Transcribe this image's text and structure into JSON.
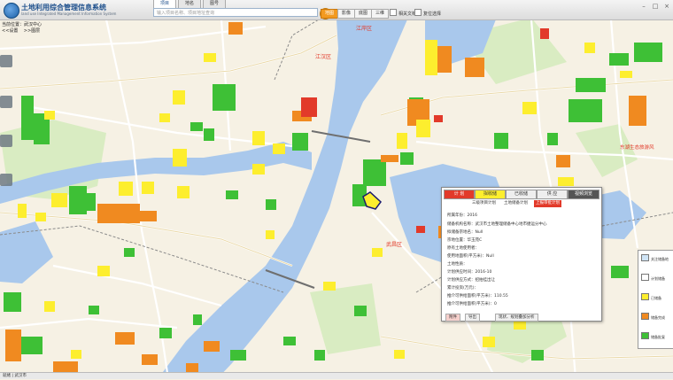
{
  "app": {
    "title": "土地利用综合管理信息系统",
    "subtitle": "land use Integrated Management Information System"
  },
  "search_tabs": [
    "项目",
    "地名",
    "图号"
  ],
  "search": {
    "placeholder": "输入项目名称、项目地址查询"
  },
  "layer_buttons": [
    "地图",
    "影像",
    "底图",
    "三维"
  ],
  "toggles": [
    "相关文档",
    "复位选择"
  ],
  "breadcrumb": {
    "current_label": "当前位置：",
    "current_value": "武汉中心",
    "nav1": "<<设置",
    "nav2": ">>图层"
  },
  "map_labels": {
    "jiangan": "江岸区",
    "jianghan": "江汉区",
    "wuchang": "武昌区",
    "donghu": "东湖生态旅游风"
  },
  "popup": {
    "tabs": [
      "计 划",
      "拟收储",
      "已收储",
      "供 应",
      "视频浏览"
    ],
    "sub_tabs": [
      "三级项目计划",
      "土地储备计划",
      "上报审批计划"
    ],
    "fields": [
      {
        "label": "所属年份：",
        "value": "2016"
      },
      {
        "label": "储备机构名称：",
        "value": "武汉市土地整理储备中心地市捷运分中心"
      },
      {
        "label": "拟储备宗地名：",
        "value": "Null"
      },
      {
        "label": "宗地位置：",
        "value": "华玉苑C"
      },
      {
        "label": "原有土地使用者：",
        "value": ""
      },
      {
        "label": "使用地面积(平方米)：",
        "value": "Null"
      },
      {
        "label": "土地性质：",
        "value": ""
      },
      {
        "label": "计划供应时间：",
        "value": "2016-10"
      },
      {
        "label": "计划供应方式：",
        "value": "招拍挂出让"
      },
      {
        "label": "累计投资(万元)：",
        "value": ""
      },
      {
        "label": "推介可供给面积(平方米)：",
        "value": "110.55"
      },
      {
        "label": "推介可供给面积(平方米)：",
        "value": "0"
      }
    ],
    "buttons": [
      "附件",
      "导出",
      "现状、规划叠加分析"
    ]
  },
  "legend": [
    "关注储备地",
    "计划储备",
    "已储备",
    "储备完成",
    "储备批复"
  ],
  "legend_colors": [
    "#cfe4f6",
    "#ffffff",
    "#ffee33",
    "#f59a27",
    "#3ec036"
  ],
  "statusbar": {
    "text": "就绪 | 武汉市"
  },
  "colors": {
    "river": "#a9c8ec",
    "land": "#f6f1e4",
    "green": "#3ec036",
    "orange": "#f08a20",
    "yellow": "#fdee2e",
    "red_block": "#e23a2a",
    "accent": "#f39a1f"
  }
}
